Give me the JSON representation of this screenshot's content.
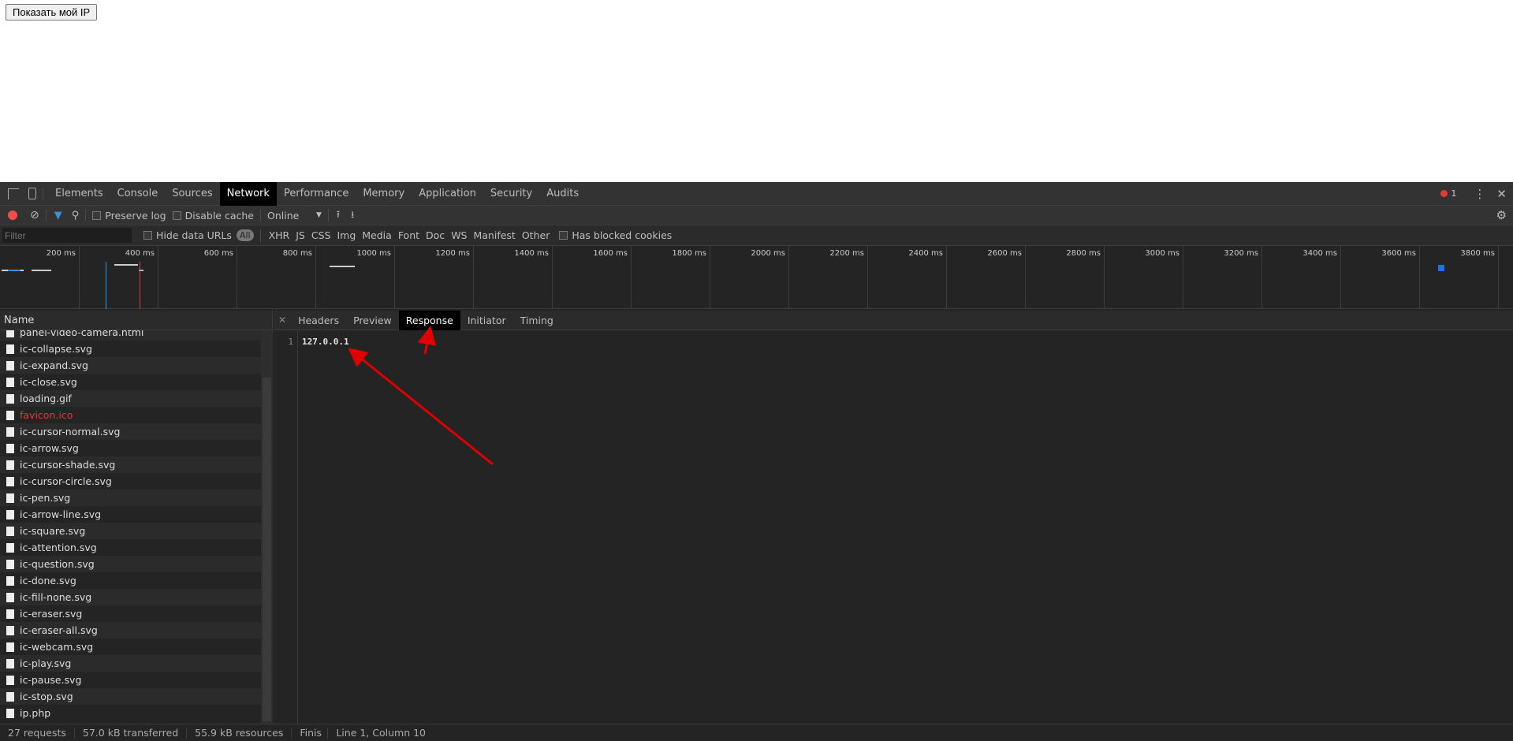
{
  "page": {
    "button_label": "Показать мой IP"
  },
  "devtools": {
    "tabs": [
      "Elements",
      "Console",
      "Sources",
      "Network",
      "Performance",
      "Memory",
      "Application",
      "Security",
      "Audits"
    ],
    "active_tab": "Network",
    "error_count": "1",
    "toolbar": {
      "preserve_log": "Preserve log",
      "disable_cache": "Disable cache",
      "throttling": "Online"
    },
    "filter": {
      "placeholder": "Filter",
      "hide_data_urls": "Hide data URLs",
      "all": "All",
      "types": [
        "XHR",
        "JS",
        "CSS",
        "Img",
        "Media",
        "Font",
        "Doc",
        "WS",
        "Manifest",
        "Other"
      ],
      "has_blocked_cookies": "Has blocked cookies"
    },
    "timeline": {
      "ticks": [
        "200 ms",
        "400 ms",
        "600 ms",
        "800 ms",
        "1000 ms",
        "1200 ms",
        "1400 ms",
        "1600 ms",
        "1800 ms",
        "2000 ms",
        "2200 ms",
        "2400 ms",
        "2600 ms",
        "2800 ms",
        "3000 ms",
        "3200 ms",
        "3400 ms",
        "3600 ms",
        "3800 ms"
      ]
    },
    "requests": {
      "header": "Name",
      "items": [
        {
          "name": "panel-video-camera.html",
          "icon": "document-icon"
        },
        {
          "name": "ic-collapse.svg",
          "icon": "image-icon"
        },
        {
          "name": "ic-expand.svg",
          "icon": "image-icon"
        },
        {
          "name": "ic-close.svg",
          "icon": "image-icon"
        },
        {
          "name": "loading.gif",
          "icon": "image-icon"
        },
        {
          "name": "favicon.ico",
          "icon": "document-icon",
          "error": true
        },
        {
          "name": "ic-cursor-normal.svg",
          "icon": "image-icon"
        },
        {
          "name": "ic-arrow.svg",
          "icon": "image-icon"
        },
        {
          "name": "ic-cursor-shade.svg",
          "icon": "image-icon"
        },
        {
          "name": "ic-cursor-circle.svg",
          "icon": "image-icon"
        },
        {
          "name": "ic-pen.svg",
          "icon": "image-icon"
        },
        {
          "name": "ic-arrow-line.svg",
          "icon": "image-icon"
        },
        {
          "name": "ic-square.svg",
          "icon": "image-icon"
        },
        {
          "name": "ic-attention.svg",
          "icon": "image-icon"
        },
        {
          "name": "ic-question.svg",
          "icon": "image-icon"
        },
        {
          "name": "ic-done.svg",
          "icon": "image-icon"
        },
        {
          "name": "ic-fill-none.svg",
          "icon": "image-icon"
        },
        {
          "name": "ic-eraser.svg",
          "icon": "image-icon"
        },
        {
          "name": "ic-eraser-all.svg",
          "icon": "image-icon"
        },
        {
          "name": "ic-webcam.svg",
          "icon": "image-icon"
        },
        {
          "name": "ic-play.svg",
          "icon": "image-icon"
        },
        {
          "name": "ic-pause.svg",
          "icon": "image-icon"
        },
        {
          "name": "ic-stop.svg",
          "icon": "image-icon"
        },
        {
          "name": "ip.php",
          "icon": "document-icon"
        }
      ]
    },
    "detail": {
      "tabs": [
        "Headers",
        "Preview",
        "Response",
        "Initiator",
        "Timing"
      ],
      "active_tab": "Response",
      "line_number": "1",
      "response_text": "127.0.0.1"
    },
    "status": {
      "requests": "27 requests",
      "transferred": "57.0 kB transferred",
      "resources": "55.9 kB resources",
      "finish": "Finis",
      "cursor": "Line 1, Column 10"
    },
    "colors": {
      "accent": "#1a73e8",
      "error": "#e53935",
      "annotation_arrow": "#e00000"
    }
  }
}
